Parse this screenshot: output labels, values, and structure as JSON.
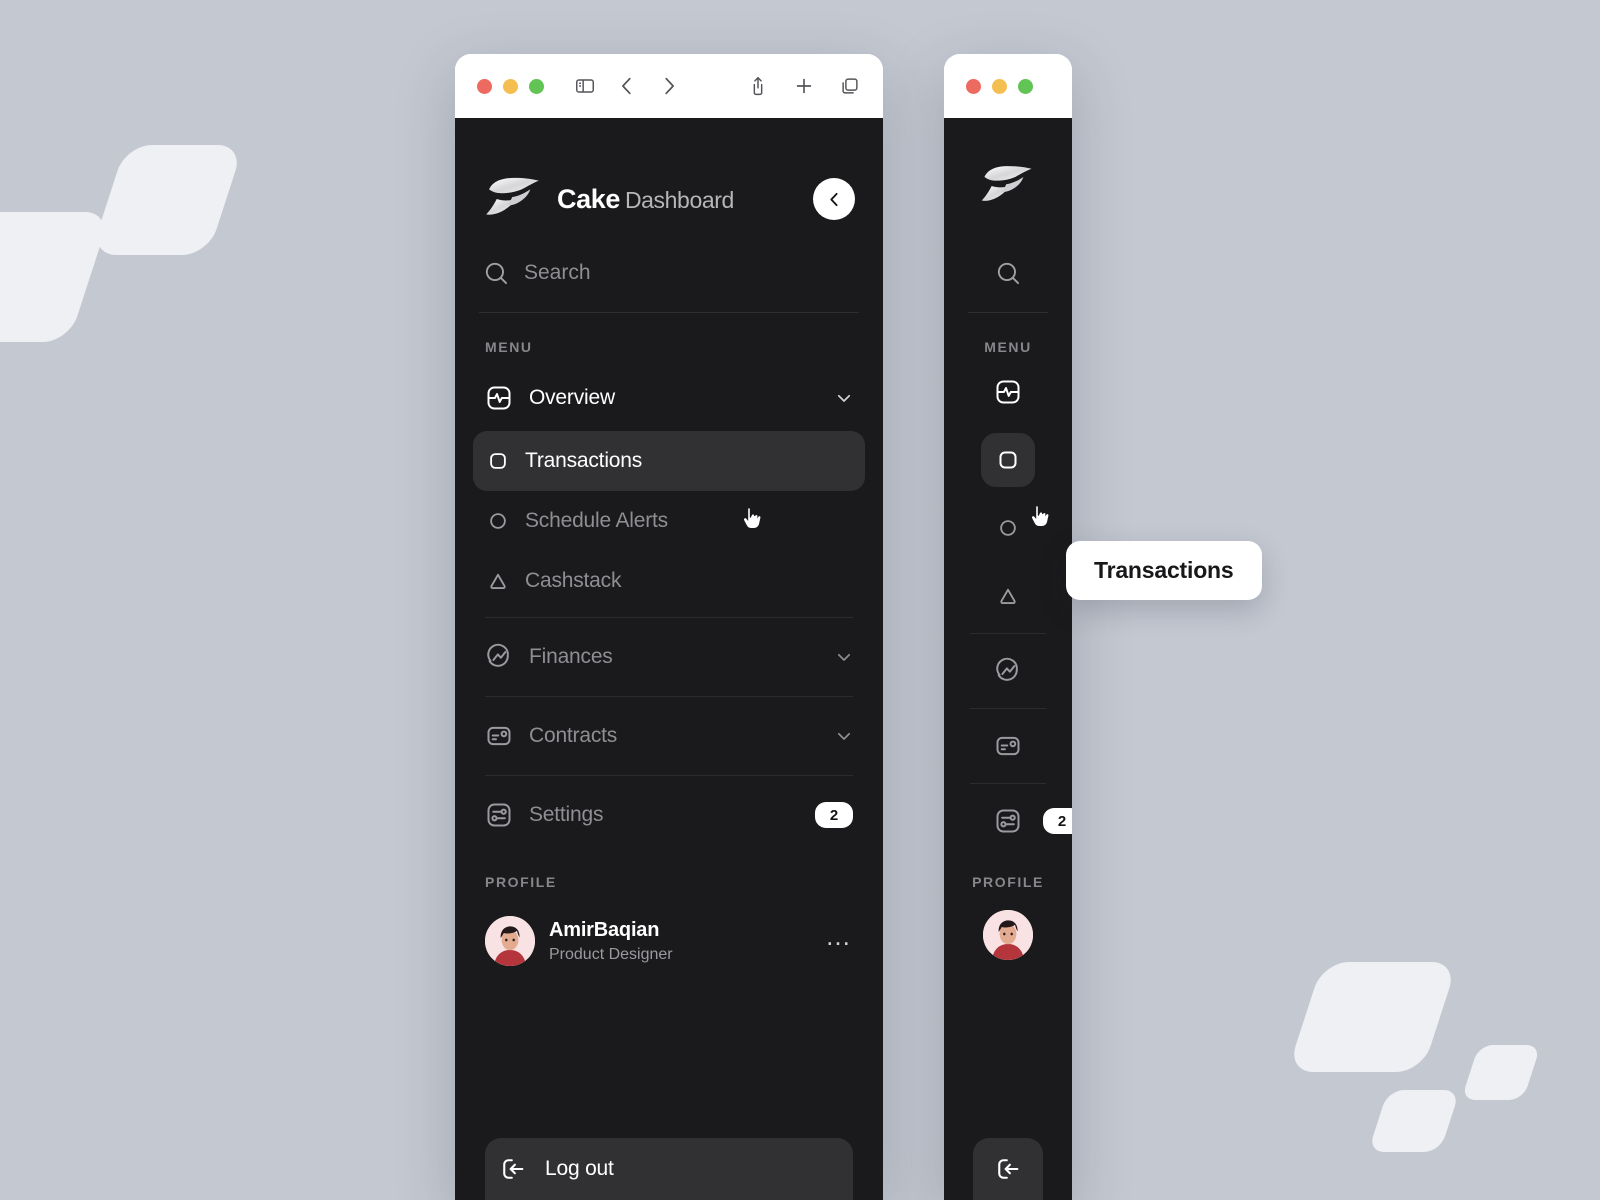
{
  "background": {
    "color": "#c3c8d1",
    "shape_color": "#eef0f4",
    "shapes": [
      "skewed-rounded-square",
      "skewed-rounded-square",
      "skewed-rounded-square",
      "skewed-rounded-square",
      "skewed-rounded-square"
    ]
  },
  "browser": {
    "traffic_lights": [
      "close",
      "minimize",
      "maximize"
    ],
    "toolbar_icons": [
      "sidebar-icon",
      "back-icon",
      "forward-icon",
      "share-icon",
      "new-tab-icon",
      "tabs-icon"
    ]
  },
  "sidebar": {
    "brand": {
      "logo": "cake-logo-icon",
      "name": "Cake",
      "subtitle": "Dashboard"
    },
    "collapse_button": "chevron-left-icon",
    "search": {
      "icon": "search-icon",
      "placeholder": "Search",
      "value": ""
    },
    "menu_label": "MENU",
    "items": [
      {
        "label": "Overview",
        "icon": "activity-square-icon",
        "state": "expanded",
        "chevron": "chevron-down-icon"
      },
      {
        "label": "Transactions",
        "icon": "square-rounded-icon",
        "state": "active"
      },
      {
        "label": "Schedule Alerts",
        "icon": "circle-icon",
        "state": "default"
      },
      {
        "label": "Cashstack",
        "icon": "triangle-icon",
        "state": "default"
      },
      {
        "label": "Finances",
        "icon": "trend-circle-icon",
        "state": "default",
        "chevron": "chevron-down-icon"
      },
      {
        "label": "Contracts",
        "icon": "id-card-icon",
        "state": "default",
        "chevron": "chevron-down-icon"
      },
      {
        "label": "Settings",
        "icon": "sliders-square-icon",
        "state": "default",
        "badge": "2"
      }
    ],
    "profile_label": "PROFILE",
    "profile": {
      "avatar": "user-avatar",
      "name": "AmirBaqian",
      "role": "Product Designer",
      "more": "…"
    },
    "logout": {
      "icon": "logout-icon",
      "label": "Log out"
    }
  },
  "tooltip": {
    "text": "Transactions"
  },
  "cursors": [
    {
      "name": "pointing-hand-cursor",
      "target": "transactions-row"
    },
    {
      "name": "pointing-hand-cursor",
      "target": "collapsed-transactions-icon"
    }
  ]
}
